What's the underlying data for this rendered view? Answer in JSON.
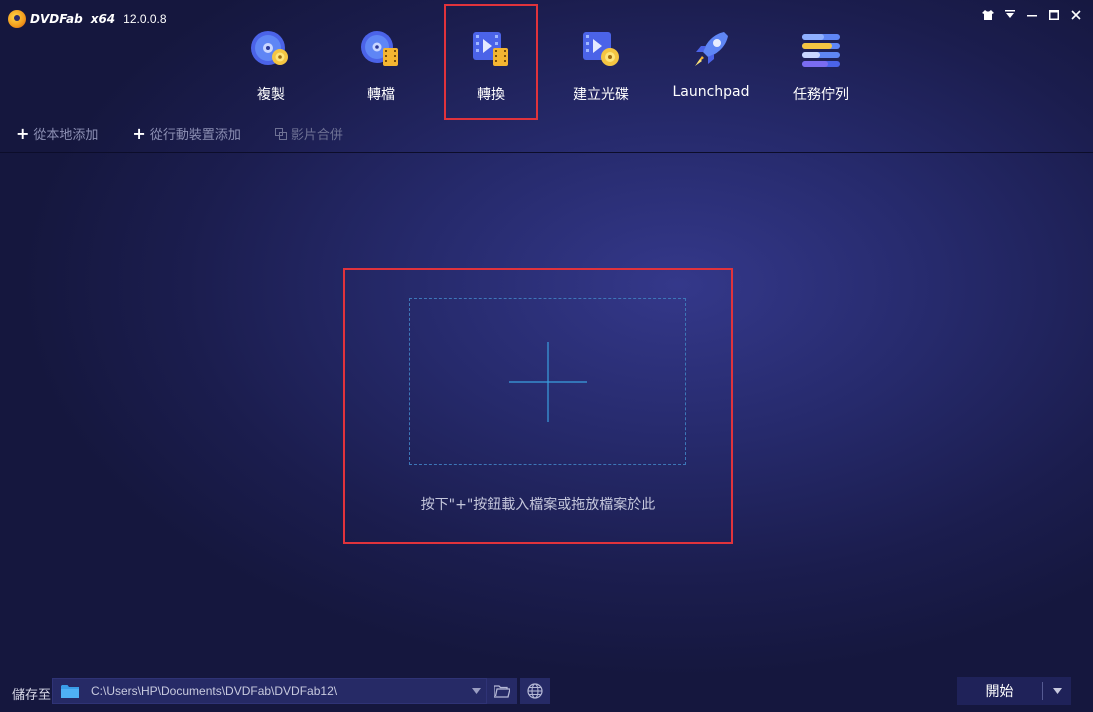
{
  "app": {
    "logo_text": "DVDFab",
    "arch": "x64",
    "version": "12.0.0.8"
  },
  "window_controls": [
    "skin-icon",
    "menu-icon",
    "minimize-icon",
    "maximize-icon",
    "close-icon"
  ],
  "nav": {
    "items": [
      {
        "label": "複製",
        "icon": "copy-disc-icon",
        "active": false
      },
      {
        "label": "轉檔",
        "icon": "ripper-icon",
        "active": false
      },
      {
        "label": "轉換",
        "icon": "converter-icon",
        "active": true
      },
      {
        "label": "建立光碟",
        "icon": "creator-icon",
        "active": false
      },
      {
        "label": "Launchpad",
        "icon": "rocket-icon",
        "active": false
      },
      {
        "label": "任務佇列",
        "icon": "task-queue-icon",
        "active": false
      }
    ]
  },
  "toolbar": {
    "add_local": "從本地添加",
    "add_mobile": "從行動裝置添加",
    "merge": "影片合併"
  },
  "drop": {
    "hint": "按下\"+\"按鈕載入檔案或拖放檔案於此"
  },
  "bottom": {
    "save_to_label": "儲存至",
    "path": "C:\\Users\\HP\\Documents\\DVDFab\\DVDFab12\\",
    "start_label": "開始"
  },
  "colors": {
    "highlight": "#e0333c",
    "accent": "#3aa0e0"
  }
}
